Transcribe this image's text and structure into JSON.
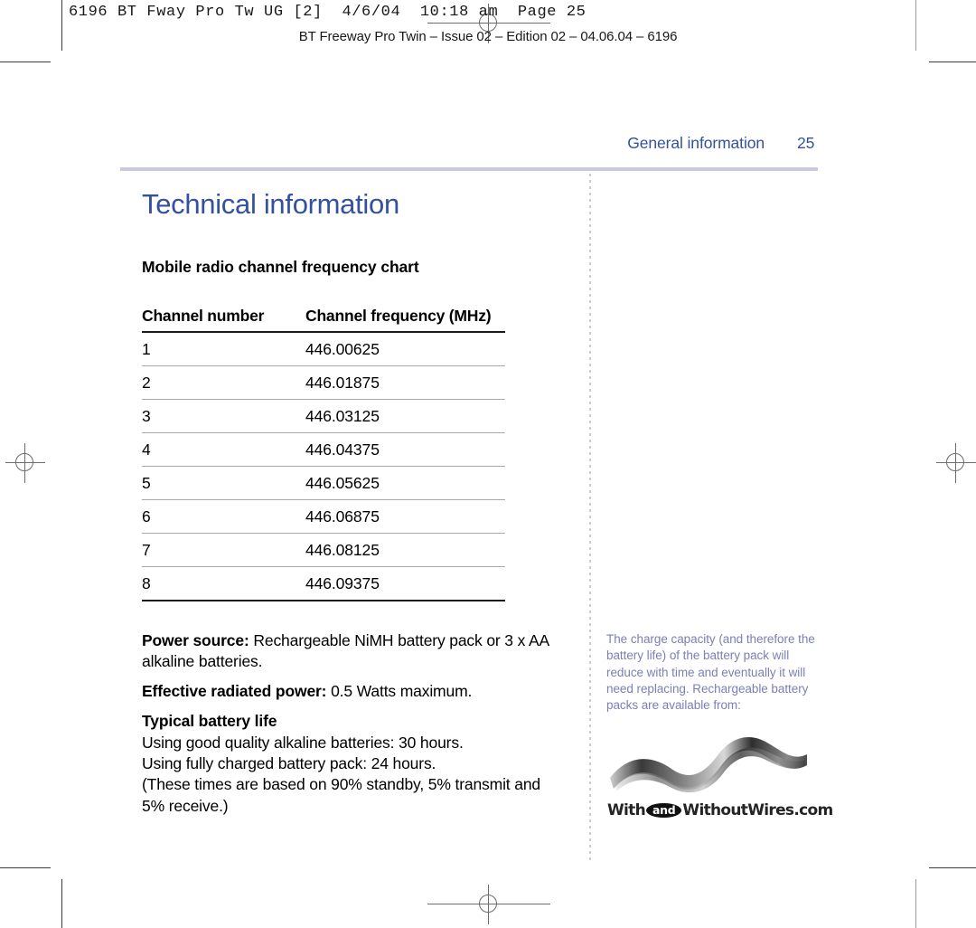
{
  "prepress": {
    "slug": "6196 BT Fway Pro Tw UG [2]  4/6/04  10:18 am  Page 25",
    "imprint": "BT Freeway Pro Twin – Issue 02 – Edition 02 – 04.06.04 – 6196"
  },
  "running_head": {
    "label": "General information",
    "page_number": "25"
  },
  "main": {
    "title": "Technical information",
    "section_heading": "Mobile radio channel frequency chart",
    "table": {
      "headers": [
        "Channel number",
        "Channel frequency (MHz)"
      ],
      "rows": [
        [
          "1",
          "446.00625"
        ],
        [
          "2",
          "446.01875"
        ],
        [
          "3",
          "446.03125"
        ],
        [
          "4",
          "446.04375"
        ],
        [
          "5",
          "446.05625"
        ],
        [
          "6",
          "446.06875"
        ],
        [
          "7",
          "446.08125"
        ],
        [
          "8",
          "446.09375"
        ]
      ]
    },
    "specs": {
      "power_source_label": "Power source:",
      "power_source_value": " Rechargeable NiMH battery pack or 3 x AA alkaline batteries.",
      "erp_label": "Effective radiated power:",
      "erp_value": " 0.5 Watts maximum.",
      "battery_life_heading": "Typical battery life",
      "battery_life_lines": [
        "Using good quality alkaline batteries: 30 hours.",
        "Using fully charged battery pack: 24 hours.",
        "(These times are based on 90% standby, 5% transmit and 5% receive.)"
      ]
    }
  },
  "sidebar": {
    "note": "The charge capacity (and therefore the battery life) of the battery pack will reduce with time and eventually it will need replacing. Rechargeable battery packs are available from:"
  },
  "logo": {
    "word_before": "With",
    "word_pill": "and",
    "word_after": "WithoutWires.com"
  },
  "colors": {
    "heading_blue": "#33519f",
    "rule_lavender": "#c9c9e2",
    "sidebar_text": "#7b7fb5",
    "body_black": "#000000"
  }
}
